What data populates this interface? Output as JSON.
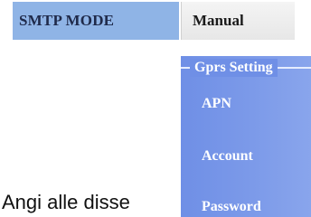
{
  "smtp": {
    "label": "SMTP MODE",
    "value": "Manual"
  },
  "gprs": {
    "title": "Gprs Setting",
    "items": [
      "APN",
      "Account",
      "Password"
    ]
  },
  "caption": "Angi alle disse",
  "colors": {
    "label_bg": "#8fb4e6",
    "panel_bg": "#7c9ae9",
    "panel_text": "#ffffff"
  }
}
